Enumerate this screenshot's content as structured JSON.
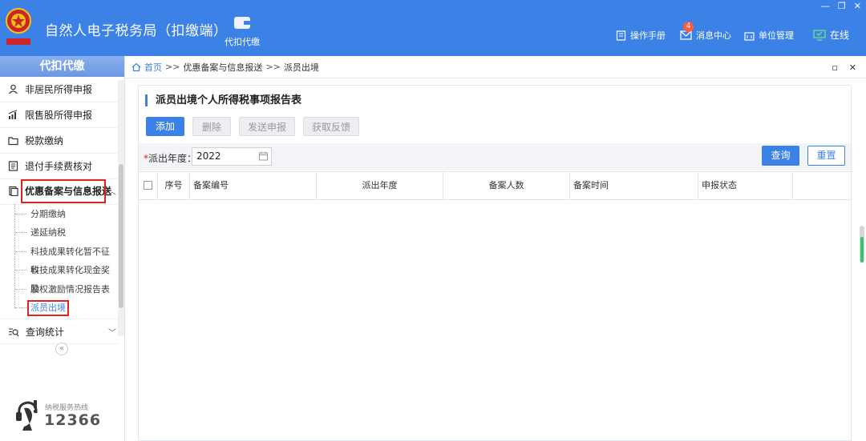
{
  "header": {
    "title": "自然人电子税务局（扣缴端）",
    "nav_tile_label": "代扣代缴",
    "links": {
      "manual": "操作手册",
      "messages": "消息中心",
      "message_count": "4",
      "unit_mgmt": "单位管理",
      "status": "在线"
    },
    "window_controls": [
      "—",
      "❐",
      "✕"
    ]
  },
  "sidebar": {
    "heading": "代扣代缴",
    "items": [
      {
        "label": "非居民所得申报",
        "icon": "person-icon"
      },
      {
        "label": "限售股所得申报",
        "icon": "chart-icon"
      },
      {
        "label": "税款缴纳",
        "icon": "folder-icon"
      },
      {
        "label": "退付手续费核对",
        "icon": "list-icon"
      },
      {
        "label": "优惠备案与信息报送",
        "icon": "document-icon"
      }
    ],
    "subitems": [
      "分期缴纳",
      "递延纳税",
      "科技成果转化暂不征收",
      "科技成果转化现金奖励",
      "股权激励情况报告表",
      "派员出境"
    ],
    "query_item": "查询统计",
    "hotline_caption": "纳税服务热线",
    "hotline_number": "12366"
  },
  "breadcrumb": {
    "home": "首页",
    "sep": ">>",
    "level1": "优惠备案与信息报送",
    "level2": "派员出境"
  },
  "panel": {
    "title": "派员出境个人所得税事项报告表",
    "buttons": {
      "add": "添加",
      "delete": "删除",
      "send": "发送申报",
      "feedback": "获取反馈",
      "query": "查询",
      "reset": "重置"
    },
    "filter": {
      "required_mark": "*",
      "label": "派出年度：",
      "year_value": "2022"
    },
    "table_columns": [
      "序号",
      "备案编号",
      "派出年度",
      "备案人数",
      "备案时间",
      "申报状态"
    ]
  }
}
